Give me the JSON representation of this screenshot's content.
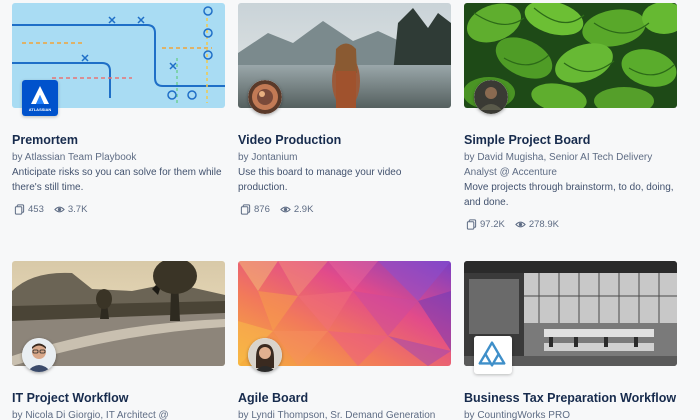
{
  "cards": [
    {
      "title": "Premortem",
      "by": "by Atlassian Team Playbook",
      "description": "Anticipate risks so you can solve for them while there's still time.",
      "copies": "453",
      "views": "3.7K",
      "logo_text": "ATLASSIAN"
    },
    {
      "title": "Video Production",
      "by": "by Jontanium",
      "description": "Use this board to manage your video production.",
      "copies": "876",
      "views": "2.9K"
    },
    {
      "title": "Simple Project Board",
      "by": "by David Mugisha, Senior AI Tech Delivery Analyst @ Accenture",
      "description": "Move projects through brainstorm, to do, doing, and done.",
      "copies": "97.2K",
      "views": "278.9K"
    },
    {
      "title": "IT Project Workflow",
      "by": "by Nicola Di Giorgio, IT Architect @"
    },
    {
      "title": "Agile Board",
      "by": "by Lyndi Thompson, Sr. Demand Generation"
    },
    {
      "title": "Business Tax Preparation Workflow",
      "by": "by CountingWorks PRO"
    }
  ],
  "colors": {
    "title": "#172b4d",
    "meta": "#5e6c84",
    "page_bg": "#f7f8f9",
    "atlassian_blue": "#0052cc"
  },
  "icons": {
    "copy": "copy-icon",
    "views": "eye-icon"
  }
}
